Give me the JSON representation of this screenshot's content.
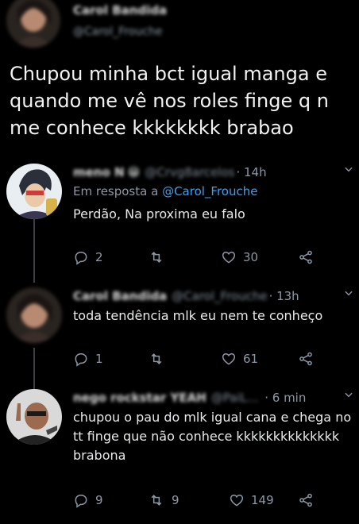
{
  "main_tweet": {
    "display_name": "Carol Bandida",
    "handle": "@Carol_Frouche",
    "text": "Chupou minha bct igual manga e quando me vê nos roles finge q n me conhece kkkkkkkk brabao"
  },
  "replies": [
    {
      "display_name": "meno N",
      "emoji": "😁",
      "handle": "@Crvg8arcelos",
      "time": "· 14h",
      "replying_prefix": "Em resposta a ",
      "replying_to": "@Carol_Frouche",
      "text": "Perdão, Na proxima eu falo",
      "reply_count": "2",
      "retweet_count": "",
      "like_count": "30"
    },
    {
      "display_name": "Carol Bandida",
      "handle": "@Carol_Frouche",
      "time": "· 13h",
      "text": "toda tendência mlk eu nem te conheço",
      "reply_count": "1",
      "retweet_count": "",
      "like_count": "61"
    },
    {
      "display_name": "nego rockstar YEAH",
      "handle": "@PaiL...",
      "time": "· 6 min",
      "text": "chupou o pau do mlk igual cana e chega no tt finge que não conhece kkkkkkkkkkkkkk brabona",
      "reply_count": "9",
      "retweet_count": "9",
      "like_count": "149"
    }
  ],
  "icons": {
    "reply": "reply-icon",
    "retweet": "retweet-icon",
    "like": "heart-icon",
    "share": "share-icon",
    "more": "chevron-down-icon"
  },
  "colors": {
    "background": "#000000",
    "text": "#e7e9ea",
    "muted": "#8b98a5",
    "link": "#3ea0ee"
  }
}
